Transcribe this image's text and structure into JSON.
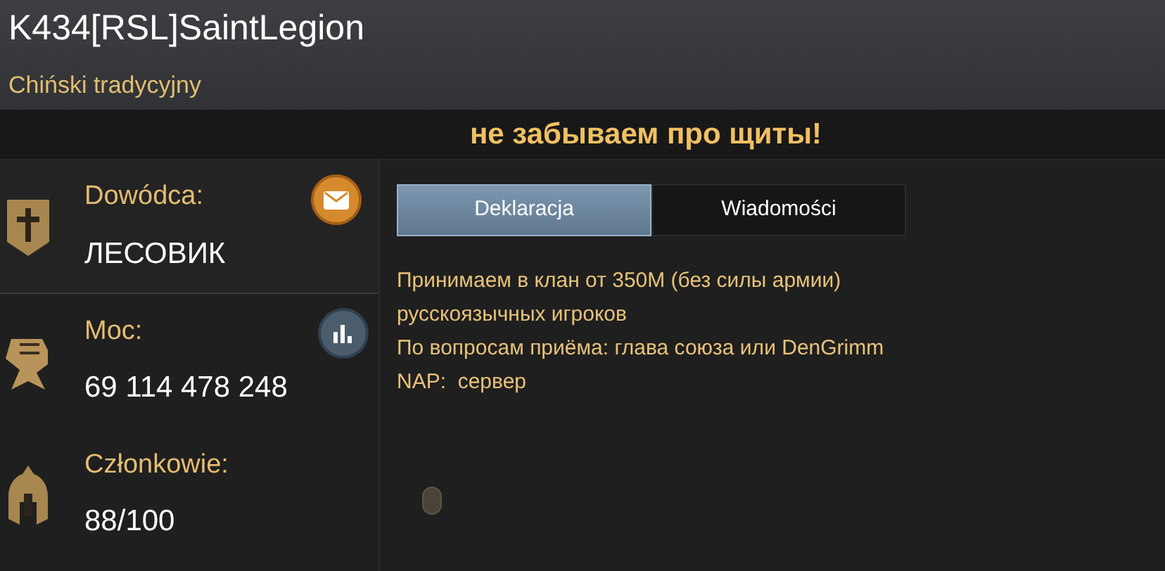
{
  "header": {
    "title": "K434[RSL]SaintLegion",
    "language": "Chiński tradycyjny"
  },
  "motto": "не забываем про щиты!",
  "stats": [
    {
      "kind": "leader",
      "label": "Dowódca:",
      "value": "ЛЕСОВИК"
    },
    {
      "kind": "power",
      "label": "Moc:",
      "value": "69 114 478 248"
    },
    {
      "kind": "members",
      "label": "Członkowie:",
      "value": "88/100"
    }
  ],
  "tabs": [
    {
      "label": "Deklaracja",
      "selected": true
    },
    {
      "label": "Wiadomości",
      "selected": false
    }
  ],
  "declaration": [
    "Принимаем в клан от 350M (без силы армии)",
    "русскоязычных игроков",
    "По вопросам приёма: глава союза или DenGrimm",
    "NAP:  сервер"
  ]
}
